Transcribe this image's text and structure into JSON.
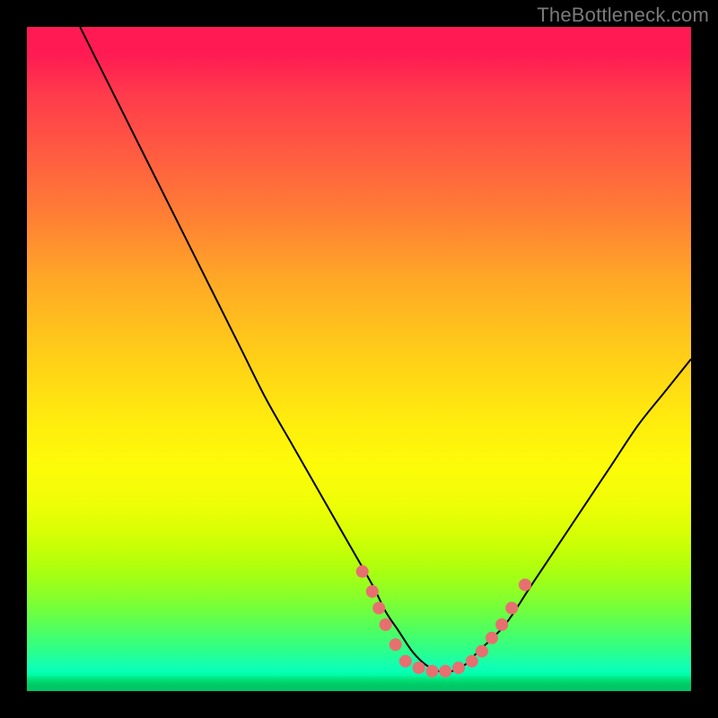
{
  "watermark": "TheBottleneck.com",
  "colors": {
    "page_bg": "#000000",
    "curve": "#000000",
    "marker": "#e86f6f",
    "gradient_top": "#ff1a53",
    "gradient_mid": "#ffee0d",
    "gradient_bottom": "#00c765"
  },
  "chart_data": {
    "type": "line",
    "title": "",
    "xlabel": "",
    "ylabel": "",
    "xlim": [
      0,
      100
    ],
    "ylim": [
      0,
      100
    ],
    "grid": false,
    "series": [
      {
        "name": "bottleneck-curve",
        "x": [
          8,
          12,
          16,
          20,
          24,
          28,
          32,
          36,
          40,
          44,
          48,
          52,
          54,
          56,
          58,
          60,
          62,
          64,
          66,
          68,
          72,
          76,
          80,
          84,
          88,
          92,
          96,
          100
        ],
        "values": [
          100,
          92,
          84,
          76,
          68,
          60,
          52,
          44,
          37,
          30,
          23,
          16,
          12,
          9,
          6,
          4,
          3,
          3,
          4,
          6,
          10,
          16,
          22,
          28,
          34,
          40,
          45,
          50
        ]
      }
    ],
    "markers": [
      {
        "x": 50.5,
        "y": 18
      },
      {
        "x": 52,
        "y": 15
      },
      {
        "x": 53,
        "y": 12.5
      },
      {
        "x": 54,
        "y": 10
      },
      {
        "x": 55.5,
        "y": 7
      },
      {
        "x": 57,
        "y": 4.5
      },
      {
        "x": 59,
        "y": 3.5
      },
      {
        "x": 61,
        "y": 3
      },
      {
        "x": 63,
        "y": 3
      },
      {
        "x": 65,
        "y": 3.5
      },
      {
        "x": 67,
        "y": 4.5
      },
      {
        "x": 68.5,
        "y": 6
      },
      {
        "x": 70,
        "y": 8
      },
      {
        "x": 71.5,
        "y": 10
      },
      {
        "x": 73,
        "y": 12.5
      },
      {
        "x": 75,
        "y": 16
      }
    ]
  }
}
